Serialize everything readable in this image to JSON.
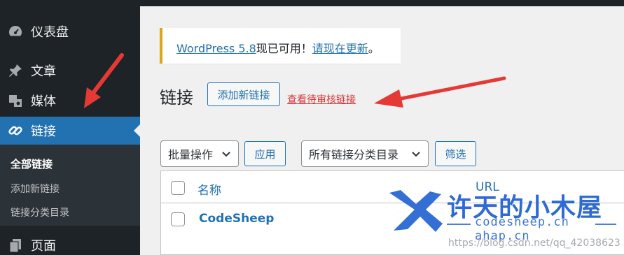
{
  "sidebar": {
    "items": [
      {
        "label": "仪表盘",
        "icon": "dashboard-icon"
      },
      {
        "label": "文章",
        "icon": "pin-icon"
      },
      {
        "label": "媒体",
        "icon": "media-icon"
      },
      {
        "label": "链接",
        "icon": "link-icon"
      },
      {
        "label": "页面",
        "icon": "page-icon"
      }
    ],
    "submenu": [
      "全部链接",
      "添加新链接",
      "链接分类目录"
    ]
  },
  "notice": {
    "text_pre": "WordPress 5.8",
    "text_mid": "现已可用！",
    "link": "请现在更新",
    "text_post": "。"
  },
  "header": {
    "title": "链接",
    "add_button": "添加新链接",
    "review_link": "查看待审核链接"
  },
  "toolbar": {
    "bulk_select": "批量操作",
    "apply_button": "应用",
    "category_select": "所有链接分类目录",
    "filter_button": "筛选"
  },
  "table": {
    "columns": [
      "名称",
      "URL"
    ],
    "rows": [
      {
        "name": "CodeSheep"
      }
    ]
  },
  "watermark": {
    "title": "许天的小木屋",
    "subtitle": "codesheep.cn",
    "subtitle2": "ahap.cn",
    "url": "https://blog.csdn.net/qq_42038623"
  },
  "colors": {
    "accent": "#2271b1",
    "sidebar": "#1d2327",
    "warning": "#dba617",
    "arrow": "#e53935"
  }
}
